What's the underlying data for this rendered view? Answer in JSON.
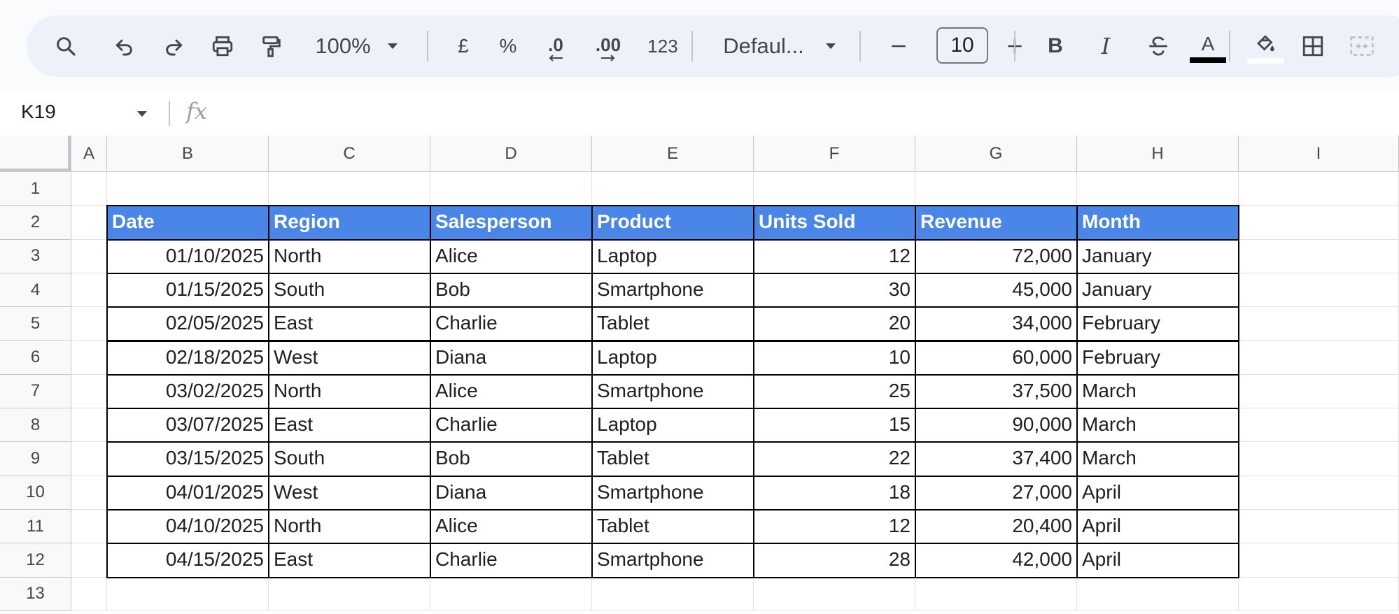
{
  "toolbar": {
    "zoom": "100%",
    "currency": "£",
    "percent": "%",
    "decrease_decimal": ".0",
    "increase_decimal": ".00",
    "number_format": "123",
    "font": "Defaul...",
    "font_size": "10",
    "bold": "B",
    "italic": "I",
    "text_color_letter": "A"
  },
  "formula_bar": {
    "name_box": "K19",
    "fx": "fx"
  },
  "columns": [
    "A",
    "B",
    "C",
    "D",
    "E",
    "F",
    "G",
    "H",
    "I"
  ],
  "rows": [
    "1",
    "2",
    "3",
    "4",
    "5",
    "6",
    "7",
    "8",
    "9",
    "10",
    "11",
    "12",
    "13"
  ],
  "table": {
    "headers": [
      "Date",
      "Region",
      "Salesperson",
      "Product",
      "Units Sold",
      "Revenue",
      "Month"
    ],
    "rows": [
      [
        "01/10/2025",
        "North",
        "Alice",
        "Laptop",
        "12",
        "72,000",
        "January"
      ],
      [
        "01/15/2025",
        "South",
        "Bob",
        "Smartphone",
        "30",
        "45,000",
        "January"
      ],
      [
        "02/05/2025",
        "East",
        "Charlie",
        "Tablet",
        "20",
        "34,000",
        "February"
      ],
      [
        "02/18/2025",
        "West",
        "Diana",
        "Laptop",
        "10",
        "60,000",
        "February"
      ],
      [
        "03/02/2025",
        "North",
        "Alice",
        "Smartphone",
        "25",
        "37,500",
        "March"
      ],
      [
        "03/07/2025",
        "East",
        "Charlie",
        "Laptop",
        "15",
        "90,000",
        "March"
      ],
      [
        "03/15/2025",
        "South",
        "Bob",
        "Tablet",
        "22",
        "37,400",
        "March"
      ],
      [
        "04/01/2025",
        "West",
        "Diana",
        "Smartphone",
        "18",
        "27,000",
        "April"
      ],
      [
        "04/10/2025",
        "North",
        "Alice",
        "Tablet",
        "12",
        "20,400",
        "April"
      ],
      [
        "04/15/2025",
        "East",
        "Charlie",
        "Smartphone",
        "28",
        "42,000",
        "April"
      ]
    ]
  },
  "colors": {
    "header_fill": "#4a86e8",
    "header_text": "#ffffff",
    "toolbar_bg": "#edf2fa"
  },
  "icons": [
    "search-icon",
    "undo-icon",
    "redo-icon",
    "print-icon",
    "paint-format-icon",
    "zoom-dropdown-icon",
    "font-dropdown-icon",
    "minus-icon",
    "plus-icon",
    "strikethrough-icon",
    "fill-color-icon",
    "borders-icon",
    "merge-cells-icon",
    "name-box-dropdown-icon",
    "fx-icon"
  ]
}
